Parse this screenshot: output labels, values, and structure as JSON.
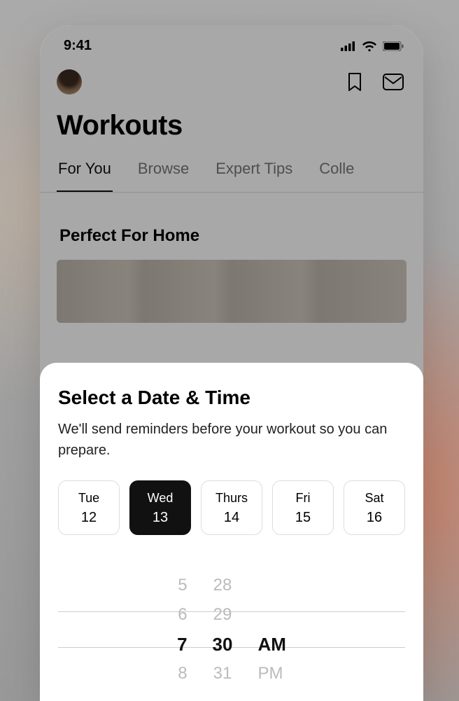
{
  "status": {
    "time": "9:41"
  },
  "header": {
    "title": "Workouts",
    "tabs": [
      "For You",
      "Browse",
      "Expert Tips",
      "Colle"
    ],
    "active_tab": 0
  },
  "section": {
    "title": "Perfect For Home"
  },
  "sheet": {
    "title": "Select a Date & Time",
    "subtitle": "We'll send reminders before your workout so you can prepare.",
    "dates": [
      {
        "dow": "Tue",
        "num": "12"
      },
      {
        "dow": "Wed",
        "num": "13"
      },
      {
        "dow": "Thurs",
        "num": "14"
      },
      {
        "dow": "Fri",
        "num": "15"
      },
      {
        "dow": "Sat",
        "num": "16"
      }
    ],
    "selected_date_index": 1,
    "picker": {
      "hours": [
        "5",
        "6",
        "7",
        "8"
      ],
      "minutes": [
        "28",
        "29",
        "30",
        "31"
      ],
      "ampm": [
        "",
        "",
        "AM",
        "PM"
      ],
      "selected_row": 2
    }
  }
}
